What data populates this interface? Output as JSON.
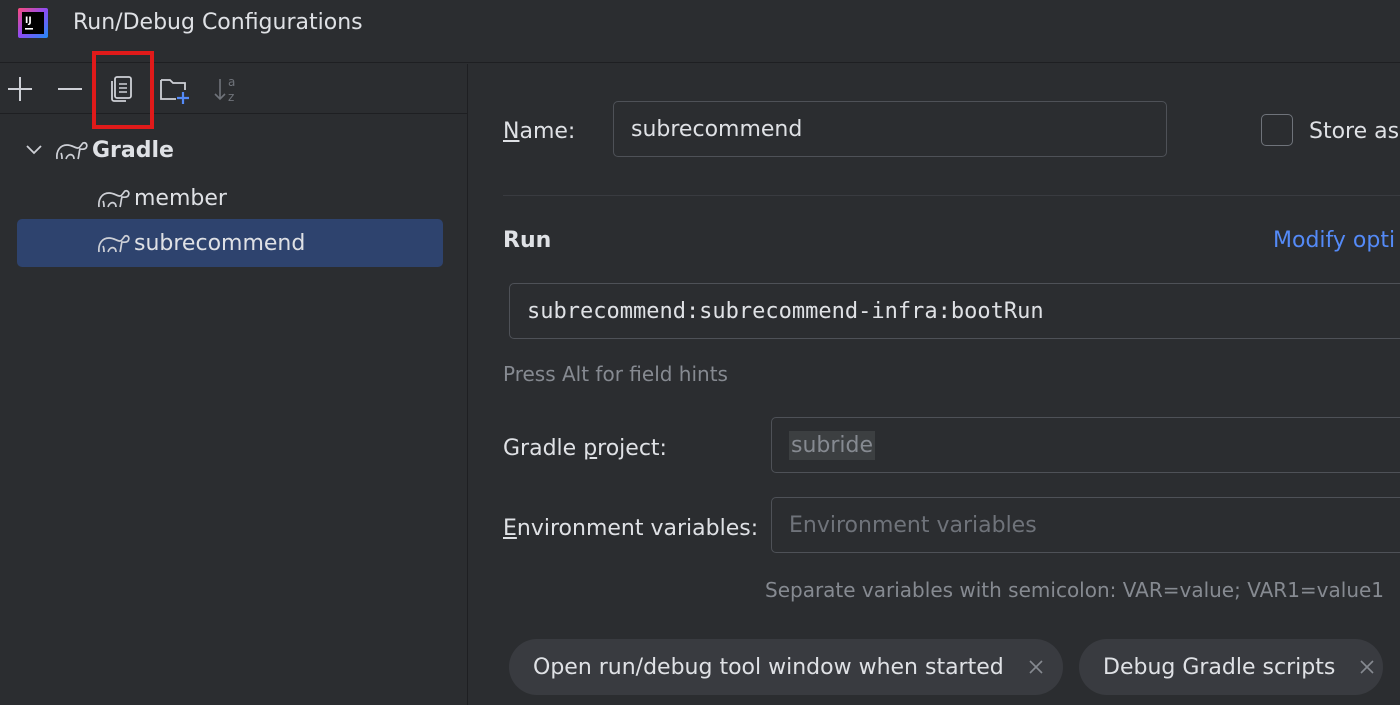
{
  "window": {
    "title": "Run/Debug Configurations"
  },
  "toolbar": {
    "add_icon": "plus-icon",
    "remove_icon": "minus-icon",
    "copy_icon": "copy-configuration-icon",
    "folder_icon": "new-folder-icon",
    "sort_icon": "sort-alphabetically-icon"
  },
  "tree": {
    "group": "Gradle",
    "items": [
      {
        "label": "member"
      },
      {
        "label": "subrecommend"
      }
    ]
  },
  "form": {
    "name_label_first": "N",
    "name_label_rest": "ame:",
    "name_value": "subrecommend",
    "store_label": "Store as",
    "run_section": "Run",
    "modify_link": "Modify opti",
    "run_command": "subrecommend:subrecommend-infra:bootRun",
    "field_hint": "Press Alt for field hints",
    "gradle_project_label_pre": "Gradle ",
    "gradle_project_label_u": "p",
    "gradle_project_label_post": "roject:",
    "gradle_project_value": "subride",
    "env_label_first": "E",
    "env_label_rest": "nvironment variables:",
    "env_placeholder": "Environment variables",
    "env_hint": "Separate variables with semicolon: VAR=value; VAR1=value1"
  },
  "tags": [
    {
      "label": "Open run/debug tool window when started"
    },
    {
      "label": "Debug Gradle scripts"
    }
  ],
  "colors": {
    "background": "#2b2d30",
    "selection": "#2e436e",
    "link": "#548af7",
    "highlight": "#e01a1a"
  }
}
